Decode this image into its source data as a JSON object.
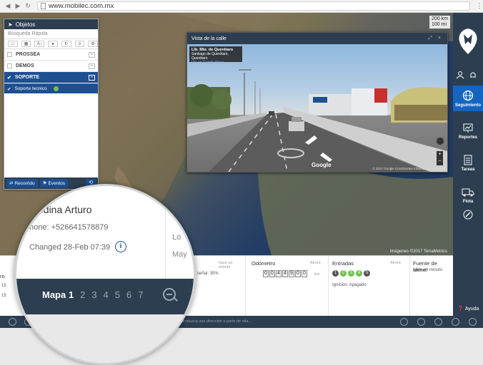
{
  "browser": {
    "url": "www.mobilec.com.mx"
  },
  "map": {
    "scale_top": "200 km",
    "scale_bottom": "100 mi",
    "credit": "Imágenes ©2017 TerraMetrics"
  },
  "objects_panel": {
    "title": "Objetos",
    "search_placeholder": "Búsqueda Rápida",
    "groups": [
      {
        "label": "PROSSEA",
        "selected": false
      },
      {
        "label": "DEMOS",
        "selected": false
      },
      {
        "label": "SOPORTE",
        "selected": true
      }
    ],
    "selected_item": {
      "label": "Soporte tecnico",
      "status_color": "#6dc24b"
    },
    "footer": {
      "route_label": "Recorrido",
      "events_label": "Eventos"
    }
  },
  "street_view": {
    "title": "Vista de la calle",
    "location_title": "Lib. Mte. de Querétaro",
    "location_sub": "Santiago de Querétaro, Querétaro",
    "location_link": "Ver en Google Maps",
    "road_text": "Lib. Mte. de Querétaro",
    "brand": "Google",
    "credit": "© 2017 Google  Condiciones  Informar un problema"
  },
  "right_nav": {
    "items": [
      {
        "label": "Seguimiento",
        "icon": "globe-icon",
        "active": true
      },
      {
        "label": "Reportes",
        "icon": "reports-icon",
        "active": false
      },
      {
        "label": "Tareas",
        "icon": "clipboard-icon",
        "active": false
      },
      {
        "label": "Flota",
        "icon": "truck-icon",
        "active": false
      }
    ],
    "help_label": "Ayuda"
  },
  "info_panel": {
    "signal_text": "ivel de señal: 35%",
    "updated_1": "hace un minuto",
    "odometer_label": "Odómetro",
    "odometer_when": "Ahora",
    "odometer_digits": [
      "0",
      "0",
      "4",
      "4",
      "9",
      "0",
      "0"
    ],
    "odometer_unit": "km",
    "inputs_label": "Entradas",
    "inputs_when": "Ahora",
    "inputs": [
      {
        "n": "1",
        "on": false
      },
      {
        "n": "2",
        "on": true
      },
      {
        "n": "3",
        "on": true
      },
      {
        "n": "4",
        "on": true
      },
      {
        "n": "5",
        "on": false
      }
    ],
    "ignition_text": "Ignición: Apagado",
    "power_label": "Fuente de alimer",
    "power_updated": "hace un minuto",
    "left_labels": [
      "ro",
      "15",
      "15"
    ]
  },
  "magnifier": {
    "name": "edina Arturo",
    "phone": "hone: +526641578879",
    "changed": "Changed 28-Feb 07:39",
    "right_1": "Lo",
    "right_2": "May",
    "tabs": [
      "Mapa 1",
      "2",
      "3",
      "4",
      "5",
      "6",
      "7"
    ]
  },
  "bottom_bar": {
    "address_placeholder": "Introduzca una dirección o parte de ella..."
  }
}
